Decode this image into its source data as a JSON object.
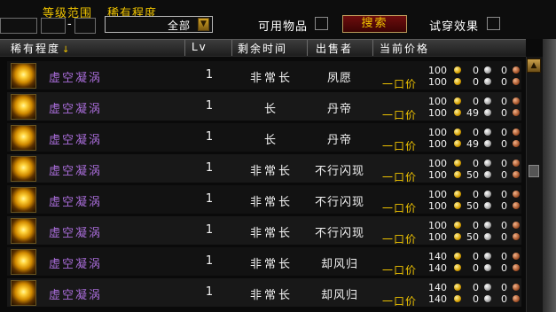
{
  "filters": {
    "level_range_label": "等级范围",
    "level_dash": "-",
    "rarity_label": "稀有程度",
    "rarity_value": "全部",
    "usable_label": "可用物品",
    "search_label": "搜索",
    "try_on_label": "试穿效果"
  },
  "columns": {
    "rarity": "稀有程度",
    "sort_indicator": "↓",
    "lv": "Lv",
    "time_left": "剩余时间",
    "seller": "出售者",
    "current_price": "当前价格"
  },
  "buyout_label": "一口价",
  "rows": [
    {
      "name": "虚空凝涡",
      "lv": "1",
      "time": "非常长",
      "seller": "夙愿",
      "bid": {
        "g": "100",
        "s": "0",
        "c": "0"
      },
      "buyout": {
        "g": "100",
        "s": "0",
        "c": "0"
      }
    },
    {
      "name": "虚空凝涡",
      "lv": "1",
      "time": "长",
      "seller": "丹帝",
      "bid": {
        "g": "100",
        "s": "0",
        "c": "0"
      },
      "buyout": {
        "g": "100",
        "s": "49",
        "c": "0"
      }
    },
    {
      "name": "虚空凝涡",
      "lv": "1",
      "time": "长",
      "seller": "丹帝",
      "bid": {
        "g": "100",
        "s": "0",
        "c": "0"
      },
      "buyout": {
        "g": "100",
        "s": "49",
        "c": "0"
      }
    },
    {
      "name": "虚空凝涡",
      "lv": "1",
      "time": "非常长",
      "seller": "不行闪现",
      "bid": {
        "g": "100",
        "s": "0",
        "c": "0"
      },
      "buyout": {
        "g": "100",
        "s": "50",
        "c": "0"
      }
    },
    {
      "name": "虚空凝涡",
      "lv": "1",
      "time": "非常长",
      "seller": "不行闪现",
      "bid": {
        "g": "100",
        "s": "0",
        "c": "0"
      },
      "buyout": {
        "g": "100",
        "s": "50",
        "c": "0"
      }
    },
    {
      "name": "虚空凝涡",
      "lv": "1",
      "time": "非常长",
      "seller": "不行闪现",
      "bid": {
        "g": "100",
        "s": "0",
        "c": "0"
      },
      "buyout": {
        "g": "100",
        "s": "50",
        "c": "0"
      }
    },
    {
      "name": "虚空凝涡",
      "lv": "1",
      "time": "非常长",
      "seller": "却风归",
      "bid": {
        "g": "140",
        "s": "0",
        "c": "0"
      },
      "buyout": {
        "g": "140",
        "s": "0",
        "c": "0"
      }
    },
    {
      "name": "虚空凝涡",
      "lv": "1",
      "time": "非常长",
      "seller": "却风归",
      "bid": {
        "g": "140",
        "s": "0",
        "c": "0"
      },
      "buyout": {
        "g": "140",
        "s": "0",
        "c": "0"
      }
    }
  ],
  "colors": {
    "item_rarity": "#a86cd8",
    "gold_text": "#f0c400",
    "search_button": "#6e0d0d"
  },
  "icons": {
    "item": "void-vortex-icon",
    "gold": "gold-coin-icon",
    "silver": "silver-coin-icon",
    "copper": "copper-coin-icon"
  }
}
